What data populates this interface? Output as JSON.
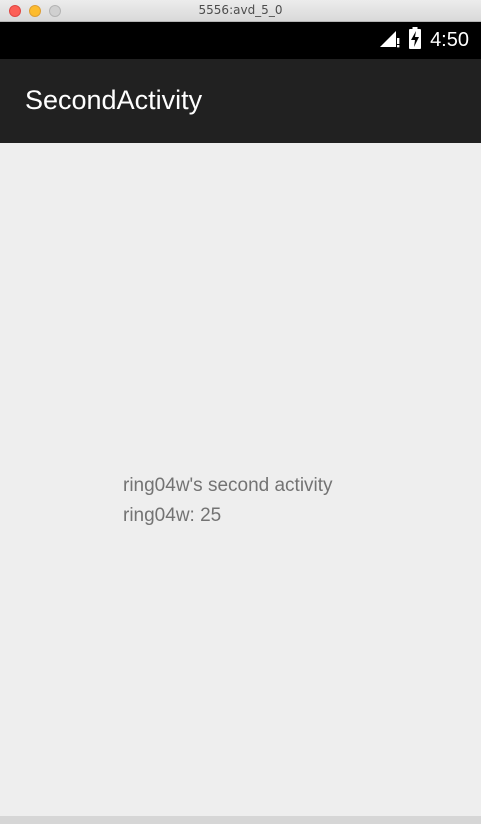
{
  "window": {
    "title": "5556:avd_5_0"
  },
  "status_bar": {
    "time": "4:50",
    "icons": [
      "signal-icon",
      "battery-charging-icon"
    ]
  },
  "app_bar": {
    "title": "SecondActivity"
  },
  "content": {
    "line1": "ring04w's second activity",
    "line2": "ring04w: 25"
  },
  "colors": {
    "app_bar": "#212121",
    "status_bar": "#000000",
    "background": "#eeeeee",
    "text": "#737373"
  }
}
